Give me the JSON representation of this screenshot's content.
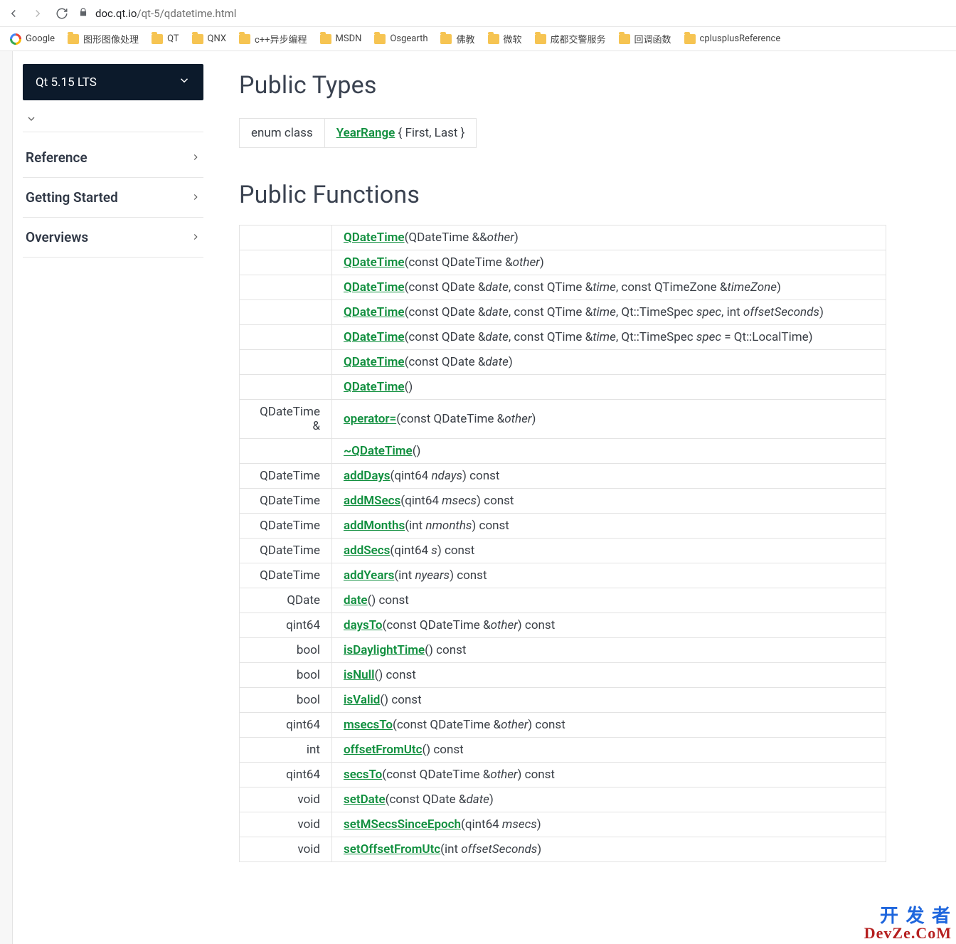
{
  "browser": {
    "url_host": "doc.qt.io",
    "url_path": "/qt-5/qdatetime.html"
  },
  "bookmarks": [
    {
      "label": "Google",
      "icon": "google"
    },
    {
      "label": "图形图像处理",
      "icon": "folder"
    },
    {
      "label": "QT",
      "icon": "folder"
    },
    {
      "label": "QNX",
      "icon": "folder"
    },
    {
      "label": "c++异步编程",
      "icon": "folder"
    },
    {
      "label": "MSDN",
      "icon": "folder"
    },
    {
      "label": "Osgearth",
      "icon": "folder"
    },
    {
      "label": "佛教",
      "icon": "folder"
    },
    {
      "label": "微软",
      "icon": "folder"
    },
    {
      "label": "成都交警服务",
      "icon": "folder"
    },
    {
      "label": "回调函数",
      "icon": "folder"
    },
    {
      "label": "cplusplusReference",
      "icon": "folder"
    }
  ],
  "sidebar": {
    "version": "Qt 5.15 LTS",
    "nav": [
      {
        "label": "Reference"
      },
      {
        "label": "Getting Started"
      },
      {
        "label": "Overviews"
      }
    ]
  },
  "headings": {
    "public_types": "Public Types",
    "public_functions": "Public Functions"
  },
  "public_types": {
    "kind": "enum class",
    "name": "YearRange",
    "after": " { First, Last }"
  },
  "functions": [
    {
      "ret": "",
      "fn": "QDateTime",
      "sig": [
        {
          "t": "(QDateTime &&"
        },
        {
          "p": "other"
        },
        {
          "t": ")"
        }
      ]
    },
    {
      "ret": "",
      "fn": "QDateTime",
      "sig": [
        {
          "t": "(const QDateTime &"
        },
        {
          "p": "other"
        },
        {
          "t": ")"
        }
      ]
    },
    {
      "ret": "",
      "fn": "QDateTime",
      "sig": [
        {
          "t": "(const QDate &"
        },
        {
          "p": "date"
        },
        {
          "t": ", const QTime &"
        },
        {
          "p": "time"
        },
        {
          "t": ", const QTimeZone &"
        },
        {
          "p": "timeZone"
        },
        {
          "t": ")"
        }
      ]
    },
    {
      "ret": "",
      "fn": "QDateTime",
      "sig": [
        {
          "t": "(const QDate &"
        },
        {
          "p": "date"
        },
        {
          "t": ", const QTime &"
        },
        {
          "p": "time"
        },
        {
          "t": ", Qt::TimeSpec "
        },
        {
          "p": "spec"
        },
        {
          "t": ", int "
        },
        {
          "p": "offsetSeconds"
        },
        {
          "t": ")"
        }
      ]
    },
    {
      "ret": "",
      "fn": "QDateTime",
      "sig": [
        {
          "t": "(const QDate &"
        },
        {
          "p": "date"
        },
        {
          "t": ", const QTime &"
        },
        {
          "p": "time"
        },
        {
          "t": ", Qt::TimeSpec "
        },
        {
          "p": "spec"
        },
        {
          "t": " = Qt::LocalTime)"
        }
      ]
    },
    {
      "ret": "",
      "fn": "QDateTime",
      "sig": [
        {
          "t": "(const QDate &"
        },
        {
          "p": "date"
        },
        {
          "t": ")"
        }
      ]
    },
    {
      "ret": "",
      "fn": "QDateTime",
      "sig": [
        {
          "t": "()"
        }
      ]
    },
    {
      "ret": "QDateTime &",
      "fn": "operator=",
      "sig": [
        {
          "t": "(const QDateTime &"
        },
        {
          "p": "other"
        },
        {
          "t": ")"
        }
      ]
    },
    {
      "ret": "",
      "fn": "~QDateTime",
      "sig": [
        {
          "t": "()"
        }
      ]
    },
    {
      "ret": "QDateTime",
      "fn": "addDays",
      "sig": [
        {
          "t": "(qint64 "
        },
        {
          "p": "ndays"
        },
        {
          "t": ") const"
        }
      ]
    },
    {
      "ret": "QDateTime",
      "fn": "addMSecs",
      "sig": [
        {
          "t": "(qint64 "
        },
        {
          "p": "msecs"
        },
        {
          "t": ") const"
        }
      ]
    },
    {
      "ret": "QDateTime",
      "fn": "addMonths",
      "sig": [
        {
          "t": "(int "
        },
        {
          "p": "nmonths"
        },
        {
          "t": ") const"
        }
      ]
    },
    {
      "ret": "QDateTime",
      "fn": "addSecs",
      "sig": [
        {
          "t": "(qint64 "
        },
        {
          "p": "s"
        },
        {
          "t": ") const"
        }
      ]
    },
    {
      "ret": "QDateTime",
      "fn": "addYears",
      "sig": [
        {
          "t": "(int "
        },
        {
          "p": "nyears"
        },
        {
          "t": ") const"
        }
      ]
    },
    {
      "ret": "QDate",
      "fn": "date",
      "sig": [
        {
          "t": "() const"
        }
      ]
    },
    {
      "ret": "qint64",
      "fn": "daysTo",
      "sig": [
        {
          "t": "(const QDateTime &"
        },
        {
          "p": "other"
        },
        {
          "t": ") const"
        }
      ]
    },
    {
      "ret": "bool",
      "fn": "isDaylightTime",
      "sig": [
        {
          "t": "() const"
        }
      ]
    },
    {
      "ret": "bool",
      "fn": "isNull",
      "sig": [
        {
          "t": "() const"
        }
      ]
    },
    {
      "ret": "bool",
      "fn": "isValid",
      "sig": [
        {
          "t": "() const"
        }
      ]
    },
    {
      "ret": "qint64",
      "fn": "msecsTo",
      "sig": [
        {
          "t": "(const QDateTime &"
        },
        {
          "p": "other"
        },
        {
          "t": ") const"
        }
      ]
    },
    {
      "ret": "int",
      "fn": "offsetFromUtc",
      "sig": [
        {
          "t": "() const"
        }
      ]
    },
    {
      "ret": "qint64",
      "fn": "secsTo",
      "sig": [
        {
          "t": "(const QDateTime &"
        },
        {
          "p": "other"
        },
        {
          "t": ") const"
        }
      ]
    },
    {
      "ret": "void",
      "fn": "setDate",
      "sig": [
        {
          "t": "(const QDate &"
        },
        {
          "p": "date"
        },
        {
          "t": ")"
        }
      ]
    },
    {
      "ret": "void",
      "fn": "setMSecsSinceEpoch",
      "sig": [
        {
          "t": "(qint64 "
        },
        {
          "p": "msecs"
        },
        {
          "t": ")"
        }
      ]
    },
    {
      "ret": "void",
      "fn": "setOffsetFromUtc",
      "sig": [
        {
          "t": "(int "
        },
        {
          "p": "offsetSeconds"
        },
        {
          "t": ")"
        }
      ]
    }
  ],
  "watermark": {
    "l1": "开 发 者",
    "l2": "DevZe.CoM"
  }
}
